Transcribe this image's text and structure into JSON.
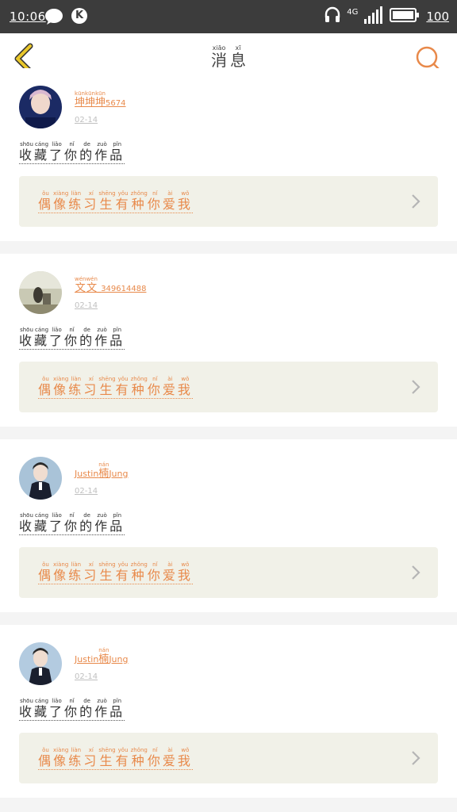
{
  "status_bar": {
    "time": "10:06",
    "network": "4G",
    "battery": "100"
  },
  "header": {
    "title": [
      {
        "char": "消",
        "py": "xiāo"
      },
      {
        "char": "息",
        "py": "xī"
      }
    ]
  },
  "messages": [
    {
      "username_chars": [
        {
          "char": "坤",
          "py": "kūn"
        },
        {
          "char": "坤",
          "py": "kūn"
        },
        {
          "char": "坤",
          "py": "kūn"
        },
        {
          "char": "5674",
          "py": ""
        }
      ],
      "time": "02-14",
      "action_chars": [
        {
          "char": "收",
          "py": "shōu"
        },
        {
          "char": "藏",
          "py": "cáng"
        },
        {
          "char": "了",
          "py": "liǎo"
        },
        {
          "char": "你",
          "py": "nǐ"
        },
        {
          "char": "的",
          "py": "de"
        },
        {
          "char": "作",
          "py": "zuò"
        },
        {
          "char": "品",
          "py": "pǐn"
        }
      ],
      "work_chars": [
        {
          "char": "偶",
          "py": "ǒu"
        },
        {
          "char": "像",
          "py": "xiàng"
        },
        {
          "char": "练",
          "py": "liàn"
        },
        {
          "char": "习",
          "py": "xí"
        },
        {
          "char": "生",
          "py": "shēng"
        },
        {
          "char": "有",
          "py": "yǒu"
        },
        {
          "char": "种",
          "py": "zhǒng"
        },
        {
          "char": "你",
          "py": "nǐ"
        },
        {
          "char": "爱",
          "py": "ài"
        },
        {
          "char": "我",
          "py": "wǒ"
        }
      ]
    },
    {
      "username_chars": [
        {
          "char": "文",
          "py": "wén"
        },
        {
          "char": "文",
          "py": "wén"
        },
        {
          "char": "_349614488",
          "py": ""
        }
      ],
      "time": "02-14",
      "action_chars": [
        {
          "char": "收",
          "py": "shōu"
        },
        {
          "char": "藏",
          "py": "cáng"
        },
        {
          "char": "了",
          "py": "liǎo"
        },
        {
          "char": "你",
          "py": "nǐ"
        },
        {
          "char": "的",
          "py": "de"
        },
        {
          "char": "作",
          "py": "zuò"
        },
        {
          "char": "品",
          "py": "pǐn"
        }
      ],
      "work_chars": [
        {
          "char": "偶",
          "py": "ǒu"
        },
        {
          "char": "像",
          "py": "xiàng"
        },
        {
          "char": "练",
          "py": "liàn"
        },
        {
          "char": "习",
          "py": "xí"
        },
        {
          "char": "生",
          "py": "shēng"
        },
        {
          "char": "有",
          "py": "yǒu"
        },
        {
          "char": "种",
          "py": "zhǒng"
        },
        {
          "char": "你",
          "py": "nǐ"
        },
        {
          "char": "爱",
          "py": "ài"
        },
        {
          "char": "我",
          "py": "wǒ"
        }
      ]
    },
    {
      "username_chars": [
        {
          "char": "Justin",
          "py": ""
        },
        {
          "char": "楠",
          "py": "nán"
        },
        {
          "char": "Jung",
          "py": ""
        }
      ],
      "time": "02-14",
      "action_chars": [
        {
          "char": "收",
          "py": "shōu"
        },
        {
          "char": "藏",
          "py": "cáng"
        },
        {
          "char": "了",
          "py": "liǎo"
        },
        {
          "char": "你",
          "py": "nǐ"
        },
        {
          "char": "的",
          "py": "de"
        },
        {
          "char": "作",
          "py": "zuò"
        },
        {
          "char": "品",
          "py": "pǐn"
        }
      ],
      "work_chars": [
        {
          "char": "偶",
          "py": "ǒu"
        },
        {
          "char": "像",
          "py": "xiàng"
        },
        {
          "char": "练",
          "py": "liàn"
        },
        {
          "char": "习",
          "py": "xí"
        },
        {
          "char": "生",
          "py": "shēng"
        },
        {
          "char": "有",
          "py": "yǒu"
        },
        {
          "char": "种",
          "py": "zhǒng"
        },
        {
          "char": "你",
          "py": "nǐ"
        },
        {
          "char": "爱",
          "py": "ài"
        },
        {
          "char": "我",
          "py": "wǒ"
        }
      ]
    },
    {
      "username_chars": [
        {
          "char": "Justin",
          "py": ""
        },
        {
          "char": "楠",
          "py": "nán"
        },
        {
          "char": "Jung",
          "py": ""
        }
      ],
      "time": "02-14",
      "action_chars": [
        {
          "char": "收",
          "py": "shōu"
        },
        {
          "char": "藏",
          "py": "cáng"
        },
        {
          "char": "了",
          "py": "liǎo"
        },
        {
          "char": "你",
          "py": "nǐ"
        },
        {
          "char": "的",
          "py": "de"
        },
        {
          "char": "作",
          "py": "zuò"
        },
        {
          "char": "品",
          "py": "pǐn"
        }
      ],
      "work_chars": [
        {
          "char": "偶",
          "py": "ǒu"
        },
        {
          "char": "像",
          "py": "xiàng"
        },
        {
          "char": "练",
          "py": "liàn"
        },
        {
          "char": "习",
          "py": "xí"
        },
        {
          "char": "生",
          "py": "shēng"
        },
        {
          "char": "有",
          "py": "yǒu"
        },
        {
          "char": "种",
          "py": "zhǒng"
        },
        {
          "char": "你",
          "py": "nǐ"
        },
        {
          "char": "爱",
          "py": "ài"
        },
        {
          "char": "我",
          "py": "wǒ"
        }
      ]
    }
  ],
  "icons": {
    "back": "chevron-left-icon",
    "search": "search-icon",
    "work_arrow": "chevron-right-icon"
  },
  "colors": {
    "accent": "#e8894a",
    "back_icon": "#e9c72a",
    "status_bar": "#3c3c3c",
    "work_bg": "#f1f1e8"
  }
}
